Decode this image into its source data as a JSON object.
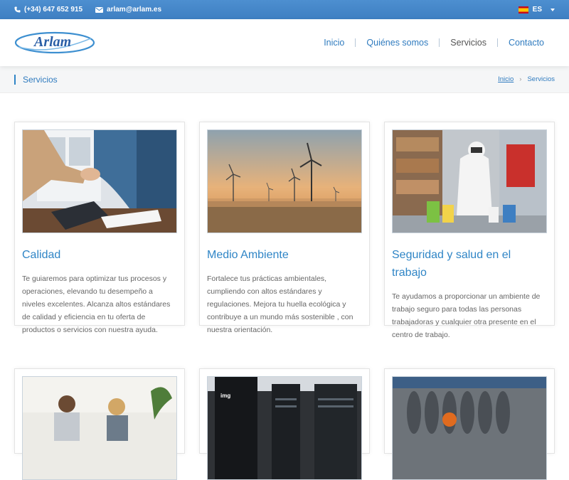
{
  "topbar": {
    "phone": "(+34) 647 652 915",
    "email": "arlam@arlam.es",
    "lang": "ES",
    "colors": {
      "background": "#4288c9"
    }
  },
  "header": {
    "logo_text": "Arlam",
    "nav": [
      {
        "label": "Inicio"
      },
      {
        "label": "Quiénes somos"
      },
      {
        "label": "Servicios"
      },
      {
        "label": "Contacto"
      }
    ]
  },
  "breadcrumb": {
    "title": "Servicios",
    "home": "Inicio",
    "current": "Servicios"
  },
  "cards": [
    {
      "title": "Calidad",
      "text": "Te guiaremos para optimizar tus procesos y operaciones, elevando tu desempeño a niveles excelentes. Alcanza altos estándares de calidad y eficiencia en tu oferta de productos o servicios con nuestra ayuda."
    },
    {
      "title": "Medio Ambiente",
      "text": "Fortalece tus prácticas ambientales, cumpliendo con altos estándares y regulaciones. Mejora tu huella ecológica y contribuye a un mundo más sostenible , con nuestra orientación."
    },
    {
      "title": "Seguridad y salud en el trabajo",
      "text": "Te ayudamos a proporcionar un ambiente de trabajo seguro para todas las personas trabajadoras y cualquier otra presente en el centro de trabajo."
    },
    {
      "title": "",
      "text": ""
    },
    {
      "title": "",
      "text": "",
      "badge": "img"
    },
    {
      "title": "",
      "text": ""
    }
  ],
  "icons": {
    "phone": "phone-icon",
    "email": "envelope-icon",
    "flag": "spain-flag-icon",
    "caret": "caret-down-icon"
  }
}
